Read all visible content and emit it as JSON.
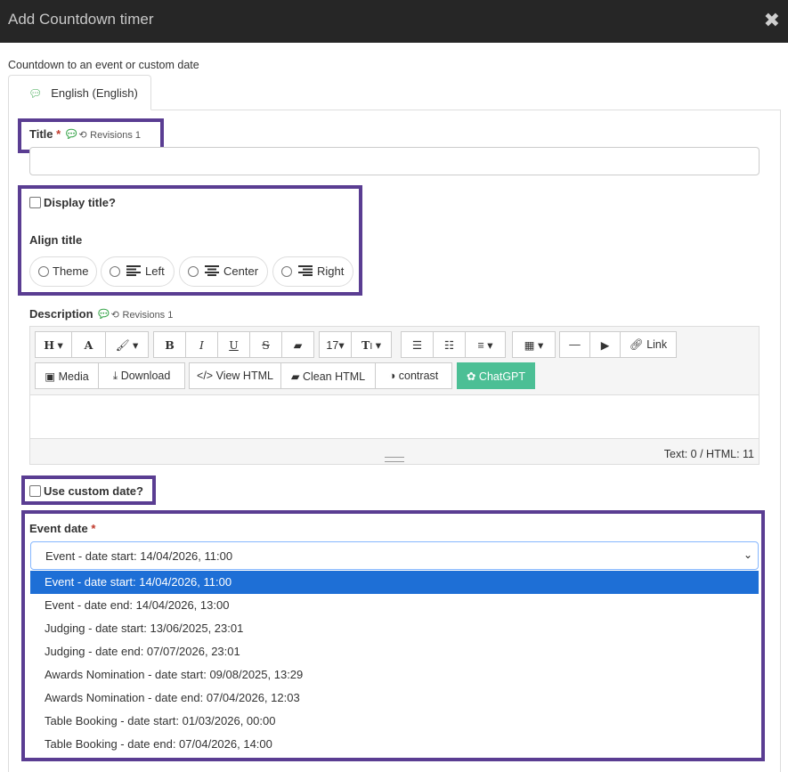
{
  "dialog": {
    "title": "Add Countdown timer",
    "close_icon": "close-icon"
  },
  "subtitle": "Countdown to an event or custom date",
  "tabs": [
    {
      "label": "English (English)",
      "icon": "speech-bubble-icon"
    }
  ],
  "title_field": {
    "label": "Title",
    "required_mark": "*",
    "revisions": "Revisions 1",
    "value": ""
  },
  "display_title": {
    "label": "Display title?",
    "checked": false
  },
  "align_title": {
    "label": "Align title",
    "options": [
      "Theme",
      "Left",
      "Center",
      "Right"
    ]
  },
  "description": {
    "label": "Description",
    "revisions": "Revisions 1",
    "toolbar_row1": {
      "heading": "H",
      "font": "A",
      "bold": "B",
      "italic": "I",
      "underline": "U",
      "strike": "S",
      "font_size": "17",
      "text_size": "T",
      "link": "Link"
    },
    "toolbar_row2": {
      "media": "Media",
      "download": "Download",
      "view_html": "View HTML",
      "clean_html": "Clean HTML",
      "contrast": "contrast",
      "chatgpt": "ChatGPT"
    },
    "stats": "Text: 0 / HTML: 11"
  },
  "custom_date": {
    "label": "Use custom date?",
    "checked": false
  },
  "event_date": {
    "label": "Event date",
    "required_mark": "*",
    "selected": "Event - date start: 14/04/2026, 11:00",
    "options": [
      "Event - date start: 14/04/2026, 11:00",
      "Event - date end: 14/04/2026, 13:00",
      "Judging - date start: 13/06/2025, 23:01",
      "Judging - date end: 07/07/2026, 23:01",
      "Awards Nomination - date start: 09/08/2025, 13:29",
      "Awards Nomination - date end: 07/04/2026, 12:03",
      "Table Booking - date start: 01/03/2026, 00:00",
      "Table Booking - date end: 07/04/2026, 14:00"
    ]
  },
  "colors": {
    "header_bg": "#262626",
    "highlight": "#5a3d92",
    "selected_option": "#1e6fd6",
    "chatgpt": "#4cbf95",
    "required": "#c0392b",
    "comment_icon": "#3aa64c"
  }
}
